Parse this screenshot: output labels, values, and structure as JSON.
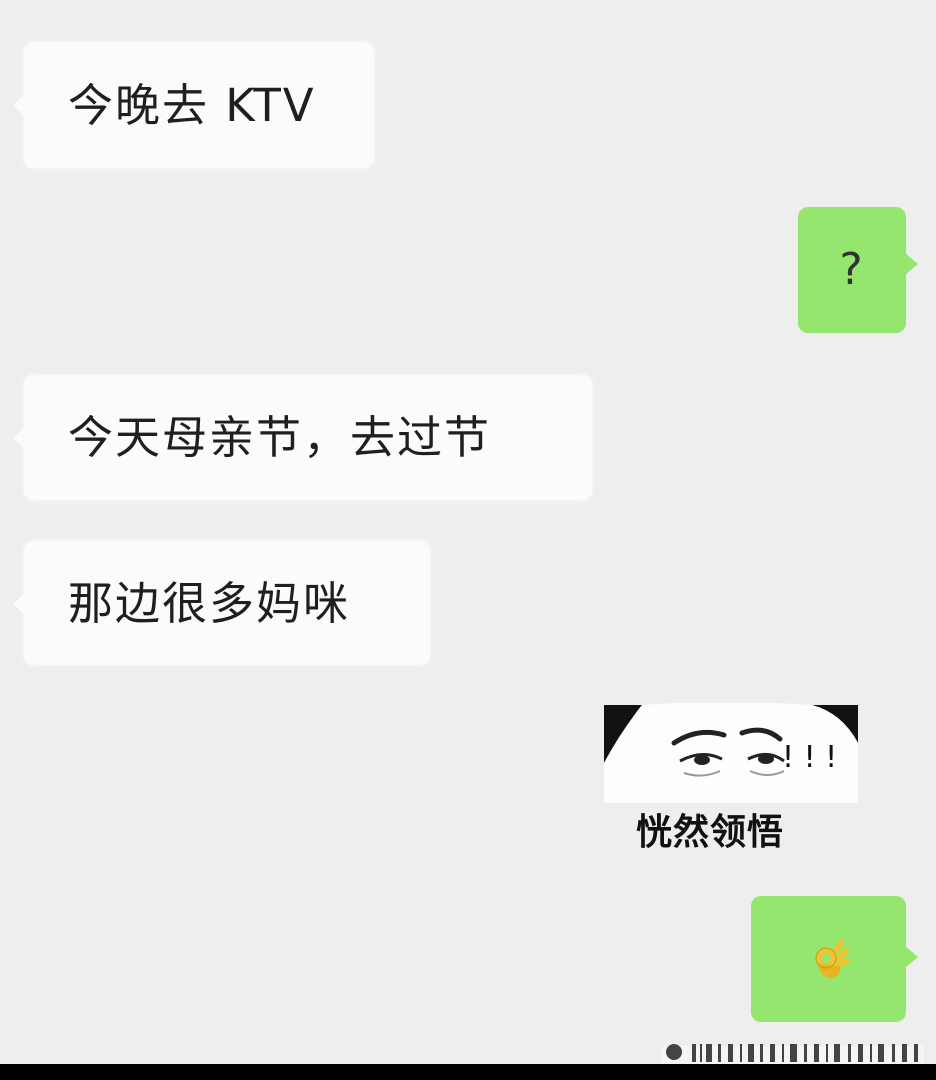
{
  "messages": [
    {
      "side": "incoming",
      "text": "今晚去 KTV"
    },
    {
      "side": "outgoing",
      "text": "?"
    },
    {
      "side": "incoming",
      "text": "今天母亲节，去过节"
    },
    {
      "side": "incoming",
      "text": "那边很多妈咪"
    },
    {
      "side": "outgoing",
      "sticker_caption": "恍然领悟",
      "sticker_exclaim": "! ! !"
    },
    {
      "side": "outgoing",
      "emoji": "ok-hand-icon"
    }
  ],
  "colors": {
    "background": "#eeeeee",
    "incoming_bubble": "#fbfbfb",
    "outgoing_bubble": "#95e66e"
  }
}
